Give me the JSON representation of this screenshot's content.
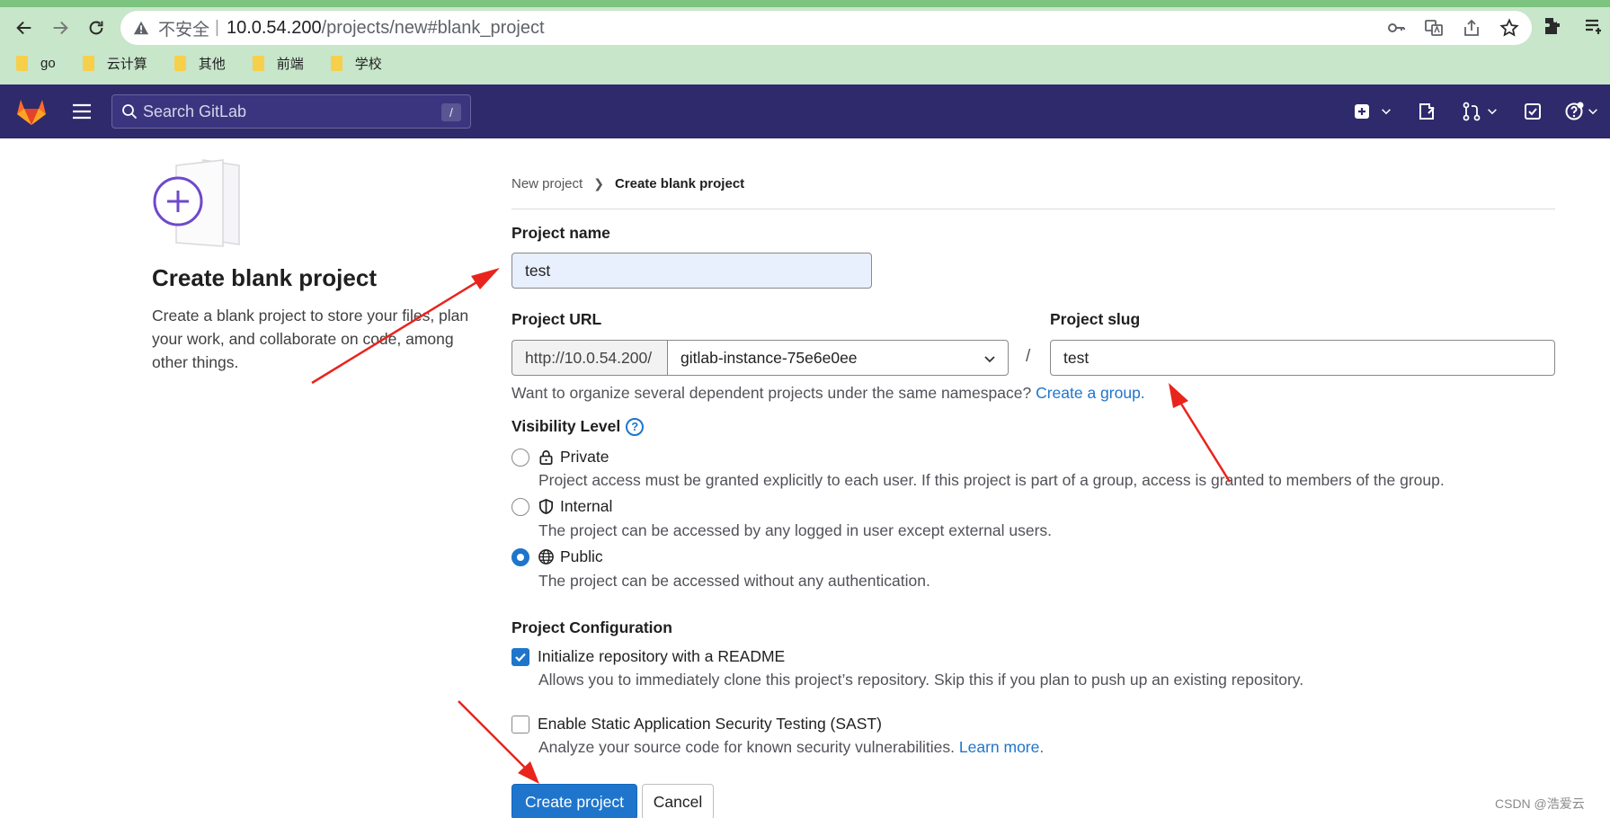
{
  "browser": {
    "insecure_label": "不安全",
    "separator": "|",
    "url_host": "10.0.54.200",
    "url_path": "/projects/new#blank_project",
    "bookmarks": [
      "go",
      "云计算",
      "其他",
      "前端",
      "学校"
    ]
  },
  "header": {
    "search_placeholder": "Search GitLab",
    "search_shortcut": "/"
  },
  "intro": {
    "title": "Create blank project",
    "description": "Create a blank project to store your files, plan your work, and collaborate on code, among other things."
  },
  "breadcrumb": {
    "parent": "New project",
    "current": "Create blank project"
  },
  "form": {
    "project_name_label": "Project name",
    "project_name_value": "test",
    "project_url_label": "Project URL",
    "url_prefix": "http://10.0.54.200/",
    "namespace": "gitlab-instance-75e6e0ee",
    "slash": "/",
    "project_slug_label": "Project slug",
    "project_slug_value": "test",
    "group_help_text": "Want to organize several dependent projects under the same namespace?",
    "create_group_link": "Create a group.",
    "visibility_label": "Visibility Level",
    "visibility_options": [
      {
        "title": "Private",
        "description": "Project access must be granted explicitly to each user. If this project is part of a group, access is granted to members of the group.",
        "checked": false,
        "icon": "lock-icon"
      },
      {
        "title": "Internal",
        "description": "The project can be accessed by any logged in user except external users.",
        "checked": false,
        "icon": "shield-icon"
      },
      {
        "title": "Public",
        "description": "The project can be accessed without any authentication.",
        "checked": true,
        "icon": "globe-icon"
      }
    ],
    "config_label": "Project Configuration",
    "readme_label": "Initialize repository with a README",
    "readme_desc": "Allows you to immediately clone this project’s repository. Skip this if you plan to push up an existing repository.",
    "readme_checked": true,
    "sast_label": "Enable Static Application Security Testing (SAST)",
    "sast_desc": "Analyze your source code for known security vulnerabilities.",
    "learn_more_link": "Learn more.",
    "sast_checked": false,
    "create_button": "Create project",
    "cancel_button": "Cancel"
  },
  "watermark": "CSDN @浩爱云",
  "colors": {
    "gitlab_header": "#2f2a6b",
    "primary": "#1f75cb",
    "annotation_arrow": "#e8241c",
    "chrome_bg": "#c8e6c9"
  }
}
